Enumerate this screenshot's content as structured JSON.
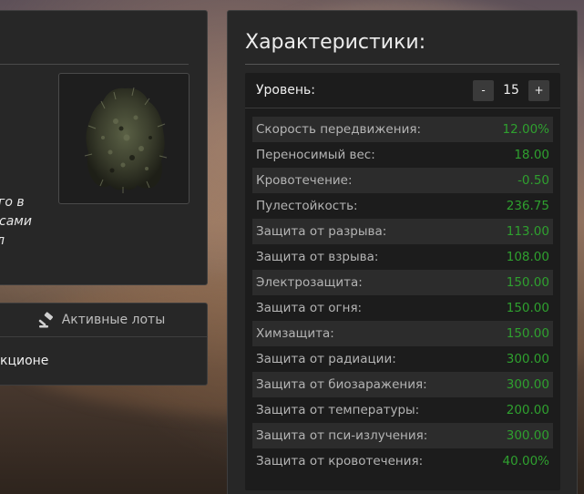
{
  "left_panel": {
    "description_lines": [
      "го в",
      "сами",
      "л"
    ]
  },
  "lots_panel": {
    "tab_label": "Активные лоты",
    "auction_text": "кционе"
  },
  "characteristics": {
    "title": "Характеристики:",
    "level": {
      "label": "Уровень:",
      "minus": "-",
      "value": "15",
      "plus": "+"
    },
    "stats": [
      {
        "name": "Скорость передвижения:",
        "value": "12.00%"
      },
      {
        "name": "Переносимый вес:",
        "value": "18.00"
      },
      {
        "name": "Кровотечение:",
        "value": "-0.50"
      },
      {
        "name": "Пулестойкость:",
        "value": "236.75"
      },
      {
        "name": "Защита от разрыва:",
        "value": "113.00"
      },
      {
        "name": "Защита от взрыва:",
        "value": "108.00"
      },
      {
        "name": "Электрозащита:",
        "value": "150.00"
      },
      {
        "name": "Защита от огня:",
        "value": "150.00"
      },
      {
        "name": "Химзащита:",
        "value": "150.00"
      },
      {
        "name": "Защита от радиации:",
        "value": "300.00"
      },
      {
        "name": "Защита от биозаражения:",
        "value": "300.00"
      },
      {
        "name": "Защита от температуры:",
        "value": "200.00"
      },
      {
        "name": "Защита от пси-излучения:",
        "value": "300.00"
      },
      {
        "name": "Защита от кровотечения:",
        "value": "40.00%"
      }
    ]
  },
  "icons": {
    "item_image": "ghillie-suit-image",
    "auction": "gavel-icon"
  },
  "colors": {
    "value_green": "#2fa02f",
    "panel_bg": "#272727"
  }
}
